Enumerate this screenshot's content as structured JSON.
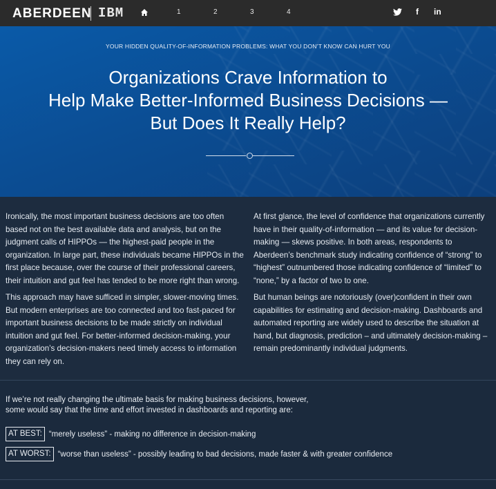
{
  "header": {
    "brand": "ABERDEEN",
    "partner": "IBM",
    "nav": [
      "1",
      "2",
      "3",
      "4"
    ],
    "icons": [
      "home-icon",
      "twitter-icon",
      "facebook-icon",
      "linkedin-icon"
    ],
    "facebook_glyph": "f",
    "linkedin_glyph": "in"
  },
  "hero": {
    "kicker": "YOUR HIDDEN QUALITY-OF-INFORMATION PROBLEMS: WHAT YOU DON’T KNOW CAN HURT YOU",
    "title_lines": [
      "Organizations Crave Information to",
      "Help Make Better-Informed Business Decisions —",
      "But Does It Really Help?"
    ]
  },
  "body": {
    "left": [
      "Ironically, the most important business decisions are too often based not on the best available data and analysis, but on the judgment calls of HIPPOs — the highest-paid people in the organization. In large part, these individuals became HIPPOs in the first place because, over the course of their professional careers, their intuition and gut feel has tended to be more right than wrong.",
      "This approach may have sufficed in simpler, slower-moving times. But modern enterprises are too connected and too fast-paced for important business decisions to be made strictly on individual intuition and gut feel. For better-informed decision-making, your organization’s decision-makers need timely access to information they can rely on."
    ],
    "right": [
      "At first glance, the level of confidence that organizations currently have in their quality-of-information — and its value for decision-making — skews positive. In both areas, respondents to Aberdeen’s benchmark study indicating confidence of “strong” to “highest” outnumbered those indicating confidence of “limited” to “none,” by a factor of two to one.",
      "But human beings are notoriously (over)confident in their own capabilities for estimating and decision-making. Dashboards and automated reporting are widely used to describe the situation at hand, but diagnosis, prediction – and ultimately decision-making – remain predominantly individual judgments."
    ]
  },
  "bottom": {
    "intro_lines": [
      "If we’re not really changing the ultimate basis for making business decisions, however,",
      "some would say that the time and effort invested in dashboards and reporting are:"
    ],
    "best_label": "AT BEST:",
    "best_text": "“merely useless” -  making no difference in decision-making",
    "worst_label": "AT WORST:",
    "worst_text": "“worse than useless” - possibly leading to bad decisions, made faster & with greater confidence"
  }
}
